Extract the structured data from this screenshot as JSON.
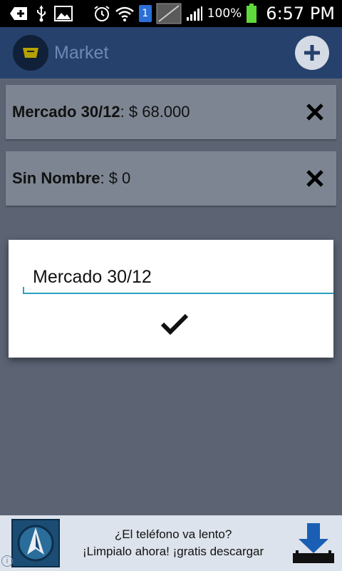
{
  "status_bar": {
    "battery_text": "100%",
    "time": "6:57 PM",
    "sim_badge": "1"
  },
  "app": {
    "title": "Market"
  },
  "list": {
    "items": [
      {
        "name": "Mercado 30/12",
        "separator": ": ",
        "amount": "$ 68.000"
      },
      {
        "name": "Sin Nombre",
        "separator": ": ",
        "amount": "$ 0"
      }
    ]
  },
  "dialog": {
    "input_value": "Mercado 30/12"
  },
  "ad": {
    "line1": "¿El teléfono va lento?",
    "line2": "¡Limpialo ahora! ¡gratis descargar",
    "info_label": "i"
  },
  "colors": {
    "action_bar": "#26416c",
    "overlay": "#5c6474",
    "accent": "#2aa1c0"
  }
}
